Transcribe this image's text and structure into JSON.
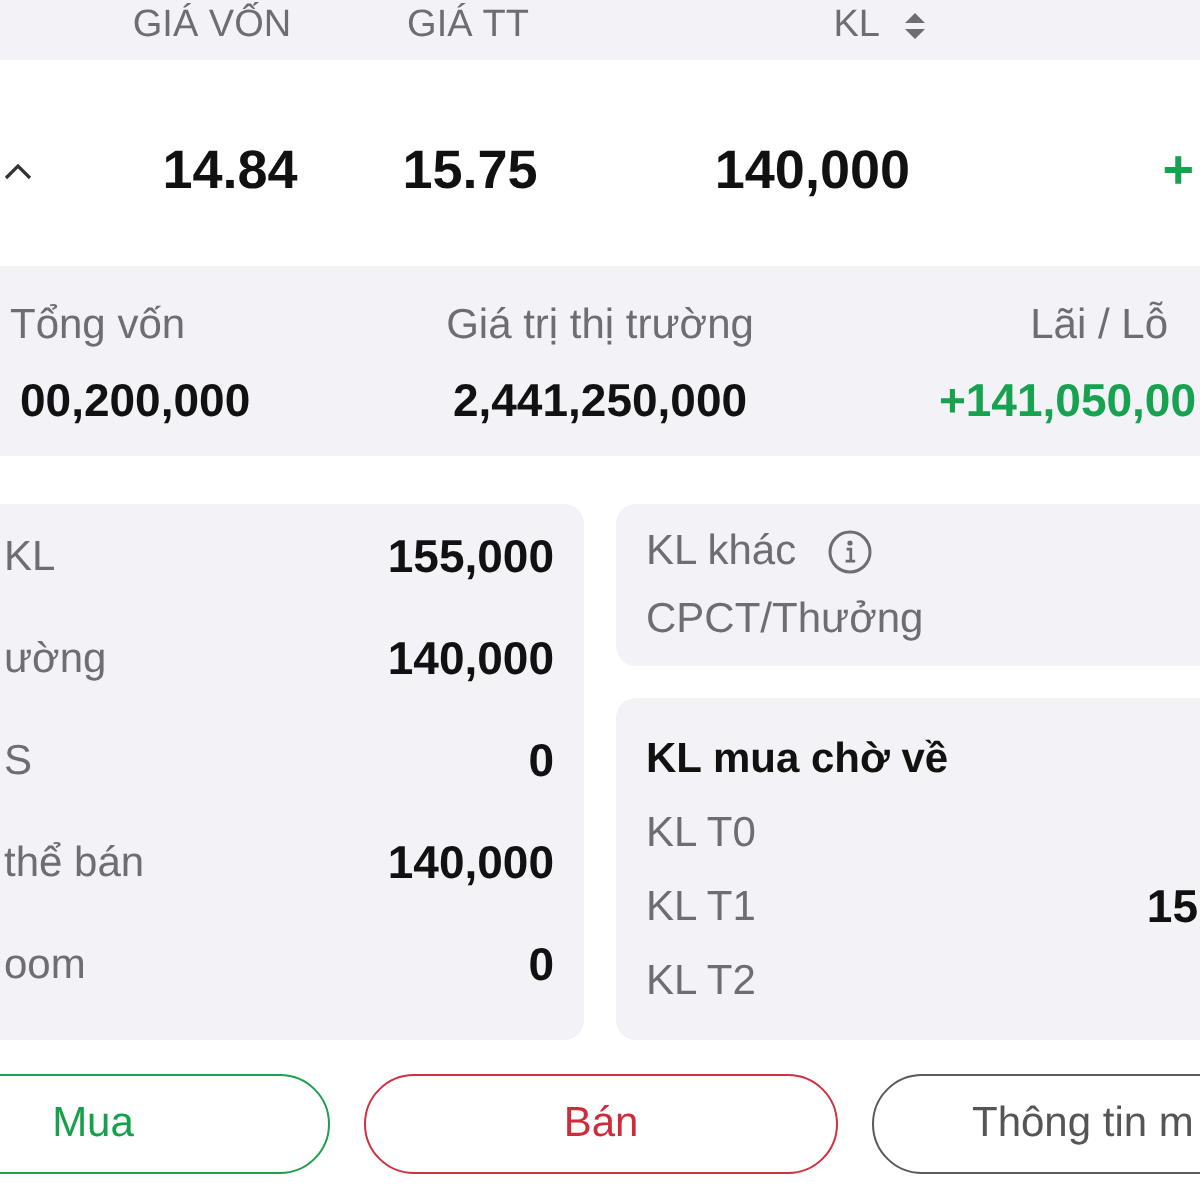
{
  "table_header": {
    "columns": [
      {
        "label": "GIÁ VỐN",
        "sortable": false
      },
      {
        "label": "GIÁ TT",
        "sortable": false
      },
      {
        "label": "KL",
        "sortable": true
      }
    ]
  },
  "position_row": {
    "expanded": true,
    "cells": [
      {
        "text": "14.84",
        "color": "#111111"
      },
      {
        "text": "15.75",
        "color": "#111111"
      },
      {
        "text": "140,000",
        "color": "#111111"
      },
      {
        "text": "+",
        "color": "#17a24f"
      }
    ]
  },
  "summary": [
    {
      "label": "Tổng vốn",
      "value": "00,200,000",
      "color": "#111111"
    },
    {
      "label": "Giá trị thị trường",
      "value": "2,441,250,000",
      "color": "#111111"
    },
    {
      "label": "Lãi / Lỗ",
      "value": "+141,050,00",
      "color": "#17a24f"
    }
  ],
  "holdings": [
    {
      "label": "KL",
      "value": "155,000"
    },
    {
      "label": "ường",
      "value": "140,000"
    },
    {
      "label": "S",
      "value": "0"
    },
    {
      "label": "thể bán",
      "value": "140,000"
    },
    {
      "label": "oom",
      "value": "0"
    }
  ],
  "other_quantity": {
    "title": "KL khác",
    "subtitle": "CPCT/Thưởng"
  },
  "pending_buy": {
    "title": "KL mua chờ về",
    "rows": [
      {
        "label": "KL T0"
      },
      {
        "label": "KL T1",
        "value": "15"
      },
      {
        "label": "KL T2"
      }
    ]
  },
  "actions": [
    {
      "label": "Mua",
      "kind": "buy"
    },
    {
      "label": "Bán",
      "kind": "sell"
    },
    {
      "label": "Thông tin m",
      "kind": "info"
    }
  ]
}
